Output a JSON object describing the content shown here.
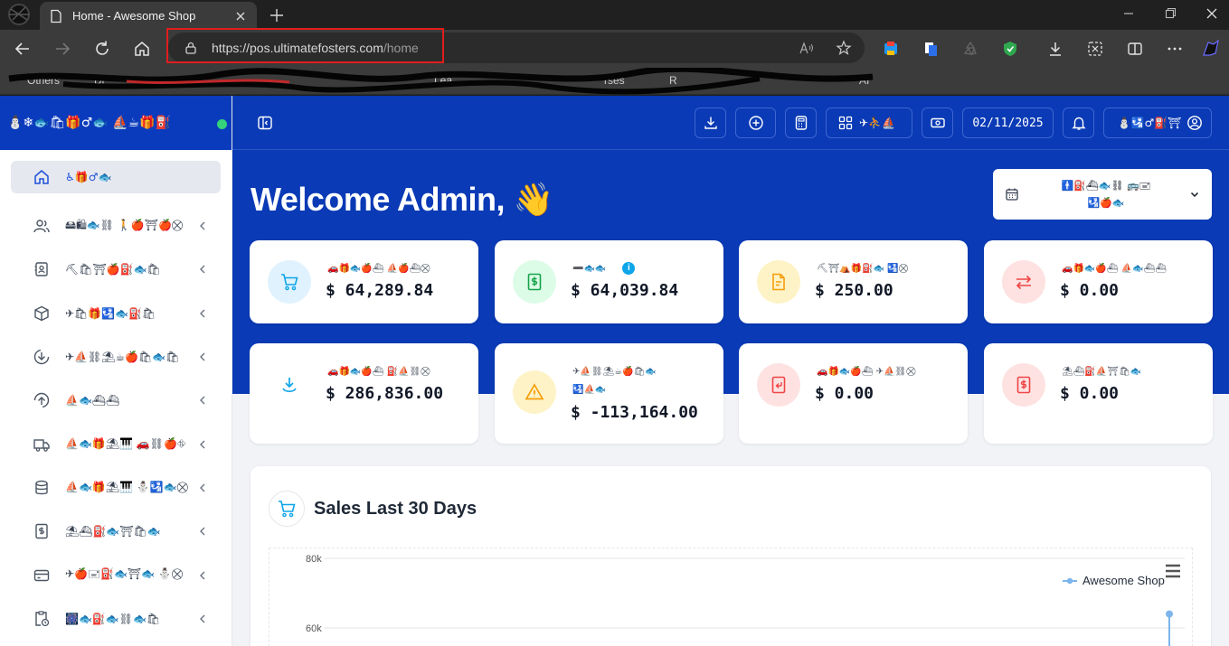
{
  "browser": {
    "tab_title": "Home - Awesome Shop",
    "url_host": "https://pos.ultimatefosters.com",
    "url_path": "/home",
    "bookmarks": [
      "Others",
      "Di",
      "A",
      "Lea",
      "rses",
      "R",
      "AI"
    ]
  },
  "sidebar": {
    "brand": "⛄❄🐟🛍🎁♂🐟  ⛵☕🎁⛽",
    "status_color": "#34d27a",
    "items": [
      {
        "label": "♿🎁♂🐟",
        "icon": "home-icon",
        "active": true,
        "has_children": false
      },
      {
        "label": "🖴🛍🐟⛓  🚶🍎⛩🍎⛒",
        "icon": "users-icon",
        "has_children": true
      },
      {
        "label": "⛏🛍⛩🍎⛽🐟🛍",
        "icon": "contacts-icon",
        "has_children": true
      },
      {
        "label": "✈🛍🎁🛂🐟⛽🛍",
        "icon": "box-icon",
        "has_children": true
      },
      {
        "label": "✈⛵⛓⛱☕🍎🛍🐟🛍",
        "icon": "download-icon",
        "has_children": true
      },
      {
        "label": "⛵🐟⛴⛴",
        "icon": "upload-icon",
        "has_children": true
      },
      {
        "label": "⛵🐟🎁⛱🎹  🚗⛓🍎⛗",
        "icon": "truck-icon",
        "has_children": true
      },
      {
        "label": "⛵🐟🎁⛱🎹  ⛄🛂🐟⛒",
        "icon": "database-icon",
        "has_children": true
      },
      {
        "label": "⛱⛴⛽🐟⛩🛍🐟",
        "icon": "receipt-icon",
        "has_children": true
      },
      {
        "label": "✈🍎🖃⛽🐟⛩🐟  ⛄⛒",
        "icon": "card-icon",
        "has_children": true
      },
      {
        "label": "🎆🐟⛽🐟⛓🐟🛍",
        "icon": "clipboard-clock-icon",
        "has_children": true
      }
    ]
  },
  "topbar": {
    "date": "02/11/2025",
    "pos_label": "✈⛹⛵",
    "user_label": "⛄🛂♂⛽⛩"
  },
  "welcome": {
    "text": "Welcome Admin,",
    "emoji": "👋"
  },
  "date_filter": {
    "line1": "🚹⛽⛴🐟⛓  🚌🖃",
    "line2": "🛂🍎🐟"
  },
  "stats": [
    {
      "label": "🚗🎁🐟🍎⛴  ⛵🍎⛴⛒",
      "value": "$ 64,289.84",
      "icon": "cart-icon",
      "bg": "#e0f2fe",
      "fg": "#0ea5e9"
    },
    {
      "label": "➖🐟🐟",
      "value": "$ 64,039.84",
      "icon": "money-receipt-icon",
      "bg": "#dcfce7",
      "fg": "#16a34a",
      "info": "i"
    },
    {
      "label": "⛏⛩⛺🎁⛽🐟  🛂⛒",
      "value": "$ 250.00",
      "icon": "document-icon",
      "bg": "#fef3c7",
      "fg": "#f59e0b"
    },
    {
      "label": "🚗🎁🐟🍎⛴  ⛵🐟⛴⛴",
      "value": "$ 0.00",
      "icon": "exchange-icon",
      "bg": "#fee2e2",
      "fg": "#ef4444"
    },
    {
      "label": "🚗🎁🐟🍎⛴  ⛽⛵⛓⛒",
      "value": "$ 286,836.00",
      "icon": "download-icon",
      "bg": "#ffffff",
      "fg": "#0ea5e9"
    },
    {
      "label": "✈⛵⛓⛱☕🍎🛍🐟",
      "label2": "🛂⛵🐟",
      "value": "$ -113,164.00",
      "icon": "warning-icon",
      "bg": "#fef3c7",
      "fg": "#f59e0b"
    },
    {
      "label": "🚗🎁🐟🍎⛴  ✈⛵⛓⛒",
      "value": "$ 0.00",
      "icon": "return-receipt-icon",
      "bg": "#fee2e2",
      "fg": "#ef4444"
    },
    {
      "label": "⛱⛴⛽⛵⛩🛍🐟",
      "value": "$ 0.00",
      "icon": "dollar-receipt-icon",
      "bg": "#fee2e2",
      "fg": "#ef4444"
    }
  ],
  "sales_chart": {
    "title": "Sales Last 30 Days",
    "chart_data": {
      "type": "line",
      "title": "Sales Last 30 Days",
      "xlabel": "",
      "ylabel": "",
      "y_tick_labels": [
        "80k",
        "60k"
      ],
      "series": [
        {
          "name": "Awesome Shop",
          "color": "#7cb5ec",
          "values_visible_tail": [
            64000
          ]
        }
      ],
      "legend": "top-right"
    }
  }
}
